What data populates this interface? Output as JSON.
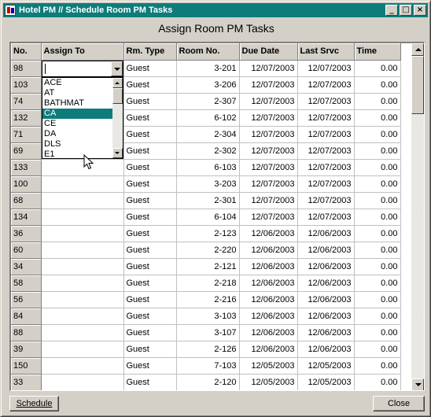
{
  "window": {
    "title": "Hotel PM // Schedule Room PM Tasks"
  },
  "heading": "Assign Room PM Tasks",
  "columns": [
    "No.",
    "Assign To",
    "Rm. Type",
    "Room No.",
    "Due Date",
    "Last Srvc",
    "Time"
  ],
  "rows": [
    [
      "98",
      "",
      "Guest",
      "3-201",
      "12/07/2003",
      "12/07/2003",
      "0.00"
    ],
    [
      "103",
      "",
      "Guest",
      "3-206",
      "12/07/2003",
      "12/07/2003",
      "0.00"
    ],
    [
      "74",
      "",
      "Guest",
      "2-307",
      "12/07/2003",
      "12/07/2003",
      "0.00"
    ],
    [
      "132",
      "",
      "Guest",
      "6-102",
      "12/07/2003",
      "12/07/2003",
      "0.00"
    ],
    [
      "71",
      "",
      "Guest",
      "2-304",
      "12/07/2003",
      "12/07/2003",
      "0.00"
    ],
    [
      "69",
      "",
      "Guest",
      "2-302",
      "12/07/2003",
      "12/07/2003",
      "0.00"
    ],
    [
      "133",
      "",
      "Guest",
      "6-103",
      "12/07/2003",
      "12/07/2003",
      "0.00"
    ],
    [
      "100",
      "",
      "Guest",
      "3-203",
      "12/07/2003",
      "12/07/2003",
      "0.00"
    ],
    [
      "68",
      "",
      "Guest",
      "2-301",
      "12/07/2003",
      "12/07/2003",
      "0.00"
    ],
    [
      "134",
      "",
      "Guest",
      "6-104",
      "12/07/2003",
      "12/07/2003",
      "0.00"
    ],
    [
      "36",
      "",
      "Guest",
      "2-123",
      "12/06/2003",
      "12/06/2003",
      "0.00"
    ],
    [
      "60",
      "",
      "Guest",
      "2-220",
      "12/06/2003",
      "12/06/2003",
      "0.00"
    ],
    [
      "34",
      "",
      "Guest",
      "2-121",
      "12/06/2003",
      "12/06/2003",
      "0.00"
    ],
    [
      "58",
      "",
      "Guest",
      "2-218",
      "12/06/2003",
      "12/06/2003",
      "0.00"
    ],
    [
      "56",
      "",
      "Guest",
      "2-216",
      "12/06/2003",
      "12/06/2003",
      "0.00"
    ],
    [
      "84",
      "",
      "Guest",
      "3-103",
      "12/06/2003",
      "12/06/2003",
      "0.00"
    ],
    [
      "88",
      "",
      "Guest",
      "3-107",
      "12/06/2003",
      "12/06/2003",
      "0.00"
    ],
    [
      "39",
      "",
      "Guest",
      "2-126",
      "12/06/2003",
      "12/06/2003",
      "0.00"
    ],
    [
      "150",
      "",
      "Guest",
      "7-103",
      "12/05/2003",
      "12/05/2003",
      "0.00"
    ],
    [
      "33",
      "",
      "Guest",
      "2-120",
      "12/05/2003",
      "12/05/2003",
      "0.00"
    ]
  ],
  "dropdown": {
    "current_value": "",
    "options": [
      "ACE",
      "AT",
      "BATHMAT",
      "CA",
      "CE",
      "DA",
      "DLS",
      "E1"
    ],
    "highlighted": "CA"
  },
  "buttons": {
    "schedule": "Schedule",
    "close": "Close"
  },
  "colors": {
    "titlebar": "#0e7c7b",
    "highlight": "#0e7c7b",
    "face": "#d4d0c8"
  }
}
